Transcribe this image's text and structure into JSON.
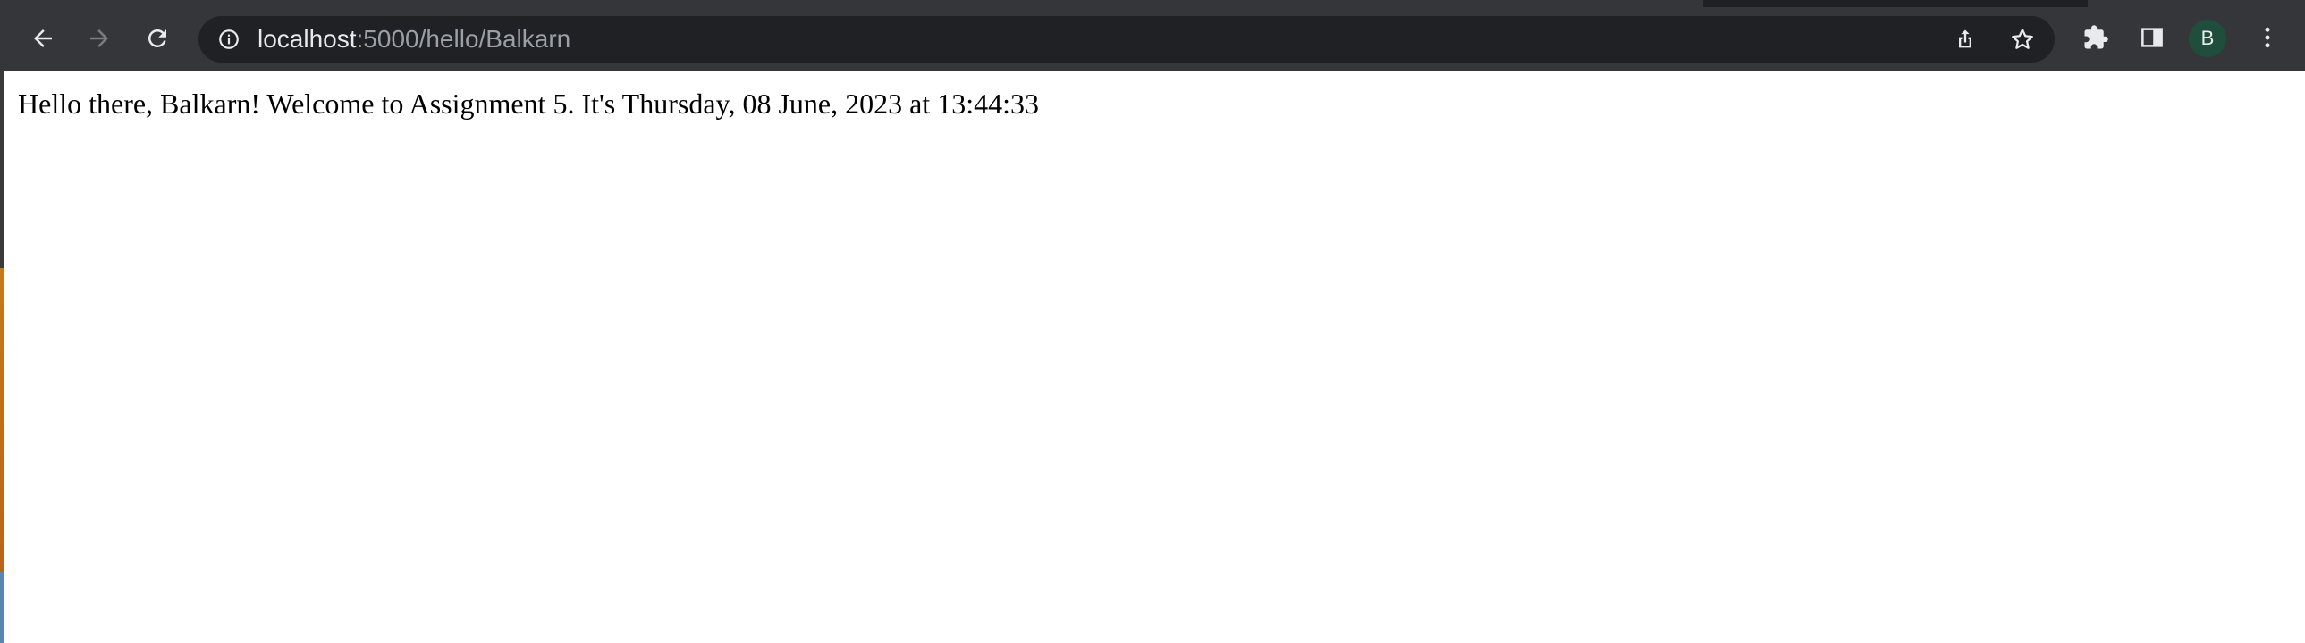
{
  "browser": {
    "url_host": "localhost",
    "url_path": ":5000/hello/Balkarn",
    "avatar_initial": "B",
    "icons": {
      "back": "arrow-left-icon",
      "forward": "arrow-right-icon",
      "reload": "reload-icon",
      "site_info": "info-icon",
      "share": "share-icon",
      "bookmark": "star-icon",
      "extensions": "puzzle-icon",
      "side_panel": "side-panel-icon",
      "menu": "kebab-menu-icon"
    },
    "colors": {
      "toolbar": "#35363a",
      "omnibox": "#202124",
      "avatar": "#1f4e3d"
    }
  },
  "page": {
    "greeting": "Hello there, Balkarn! Welcome to Assignment 5. It's Thursday, 08 June, 2023 at 13:44:33"
  }
}
